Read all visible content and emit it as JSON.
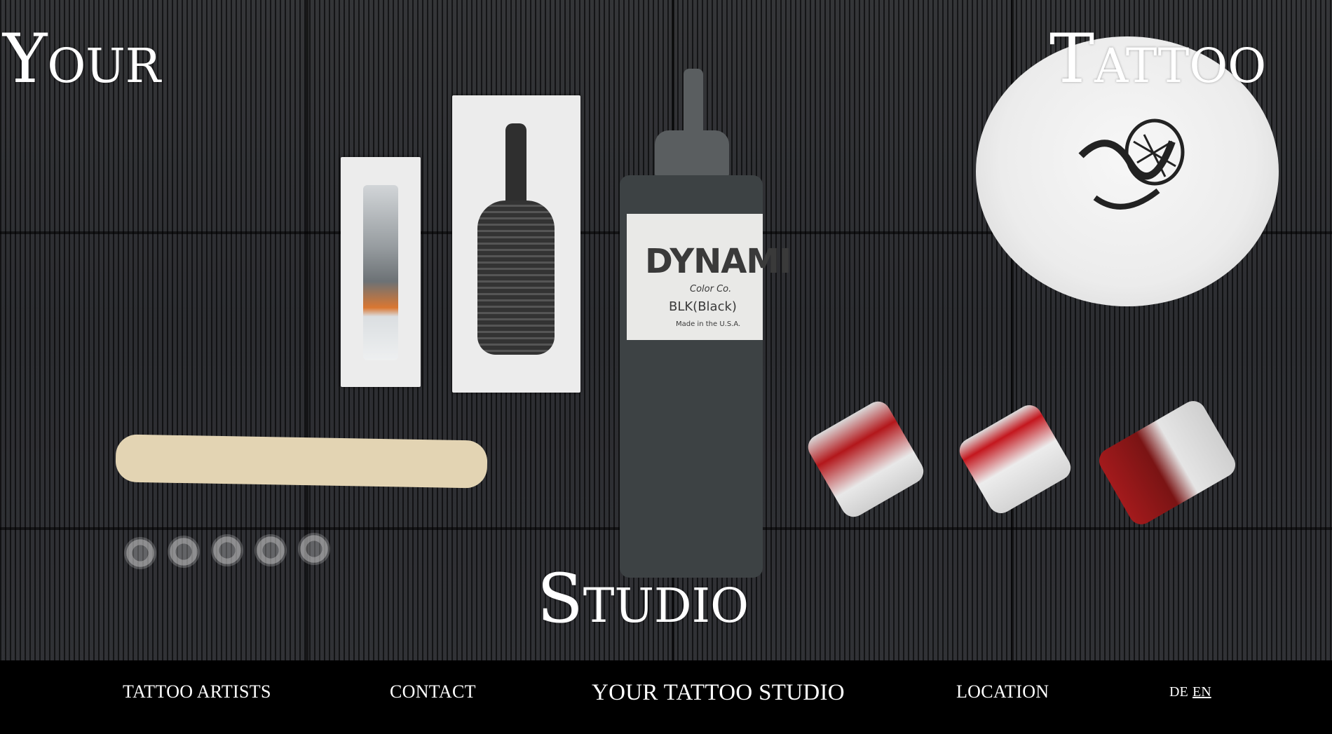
{
  "hero": {
    "words": {
      "your": "Your",
      "tattoo": "Tattoo",
      "studio": "Studio"
    },
    "bottle_label": {
      "brand": "DYNAMI",
      "sub": "Color Co.",
      "color": "BLK(Black)",
      "origin": "Made in the U.S.A."
    }
  },
  "nav": {
    "artists": "TATTOO ARTISTS",
    "contact": "CONTACT",
    "brand": "YOUR TATTOO STUDIO",
    "location": "LOCATION",
    "lang_de": "DE",
    "lang_en": "EN"
  },
  "colors": {
    "background": "#000000",
    "text": "#ffffff",
    "mat": "#2b2c2f",
    "ink_red": "#b3171b"
  }
}
